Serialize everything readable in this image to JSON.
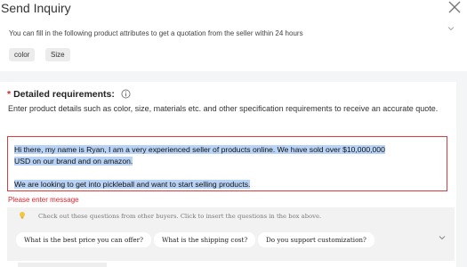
{
  "dialog": {
    "title": "Send Inquiry"
  },
  "attributes": {
    "description": "You can fill in the following product attributes to get a quotation from the seller within 24 hours",
    "chips": [
      "color",
      "Size"
    ]
  },
  "requirements": {
    "required_marker": "*",
    "heading": "Detailed requirements:",
    "description": "Enter product details such as color, size, materials etc. and other specification requirements to receive an accurate quote.",
    "textarea_lines": [
      "Hi there, my name is Ryan, I am a very experienced seller of products online. We have sold over $10,000,000",
      "USD on our brand and on amazon.",
      "",
      "We are looking to get into pickleball and want to start selling products."
    ],
    "error": "Please enter message"
  },
  "suggestions": {
    "note": "Check out these questions from other buyers. Click to insert the questions in the box above.",
    "questions": [
      "What is the best price you can offer?",
      "What is the shipping cost?",
      "Do you support customization?"
    ]
  },
  "colors": {
    "error_red": "#e0232c",
    "selection_blue": "#b8d3f5",
    "panel_bg": "#f4f5f7"
  },
  "icons": [
    "close-icon",
    "chevron-down-icon",
    "info-icon",
    "lightbulb-icon"
  ]
}
